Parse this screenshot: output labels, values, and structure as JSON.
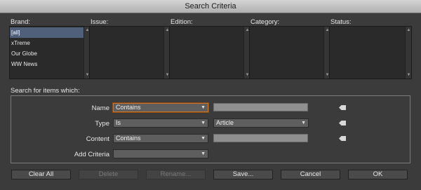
{
  "window": {
    "title": "Search Criteria"
  },
  "columns": {
    "brand": {
      "label": "Brand:",
      "items": [
        "[all]",
        "xTreme",
        "Our Globe",
        "WW News"
      ],
      "selected": "[all]"
    },
    "issue": {
      "label": "Issue:"
    },
    "edition": {
      "label": "Edition:"
    },
    "category": {
      "label": "Category:"
    },
    "status": {
      "label": "Status:"
    }
  },
  "criteria": {
    "section_label": "Search for items which:",
    "rows": {
      "name": {
        "label": "Name",
        "operator": "Contains",
        "value": ""
      },
      "type": {
        "label": "Type",
        "operator": "Is",
        "value": "Article"
      },
      "content": {
        "label": "Content",
        "operator": "Contains",
        "value": ""
      },
      "add": {
        "label": "Add Criteria",
        "value": ""
      }
    }
  },
  "buttons": {
    "clear_all": "Clear All",
    "delete": "Delete",
    "rename": "Rename...",
    "save": "Save...",
    "cancel": "Cancel",
    "ok": "OK"
  },
  "colors": {
    "focus_ring": "#c9762a",
    "selection": "#50607a",
    "title_bar": "#c0c0c0"
  }
}
